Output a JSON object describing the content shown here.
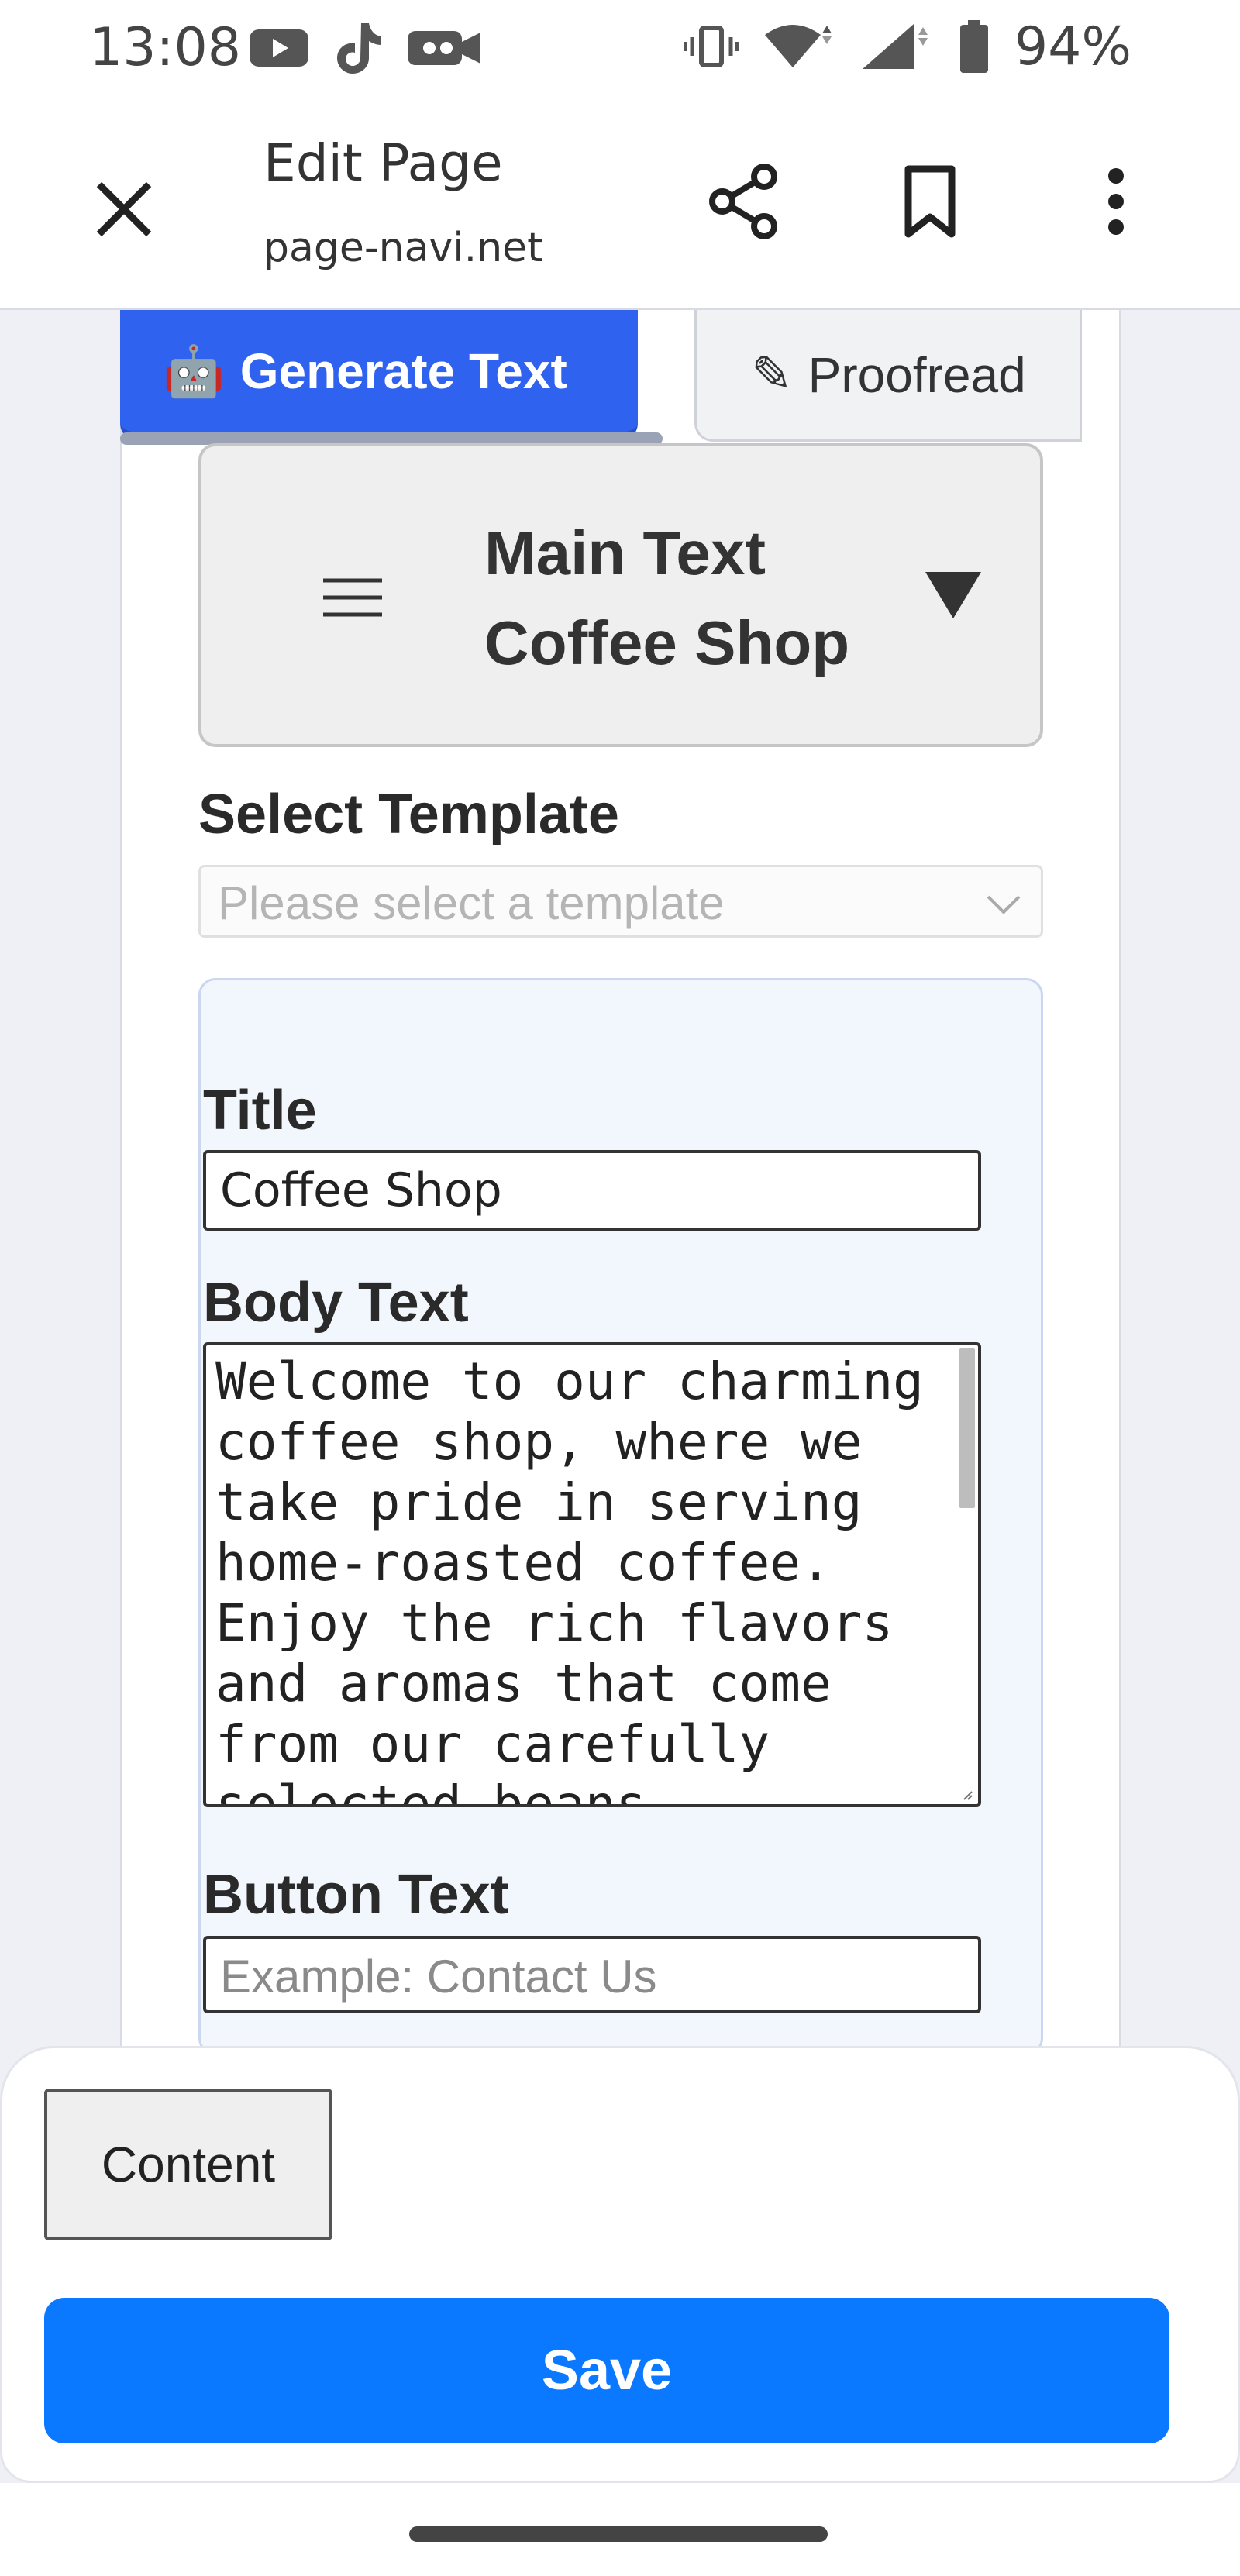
{
  "status_bar": {
    "time": "13:08",
    "battery": "94%",
    "icons_left": [
      "youtube-icon",
      "tiktok-icon",
      "video-camera-icon"
    ],
    "icons_right": [
      "vibrate-icon",
      "wifi-icon",
      "signal-icon",
      "battery-icon"
    ]
  },
  "browser": {
    "title": "Edit Page",
    "url": "page-navi.net"
  },
  "toolbar": {
    "generate_label": "Generate Text",
    "generate_icon": "🤖",
    "proofread_label": "Proofread",
    "proofread_icon": "✎"
  },
  "section": {
    "label_line1": "Main Text",
    "label_line2": "Coffee Shop"
  },
  "template": {
    "label": "Select Template",
    "placeholder": "Please select a template"
  },
  "form": {
    "title_label": "Title",
    "title_value": "Coffee Shop",
    "body_label": "Body Text",
    "body_value": "Welcome to our charming coffee shop, where we take pride in serving home-roasted coffee. Enjoy the rich flavors and aromas that come from our carefully selected beans.",
    "button_label": "Button Text",
    "button_placeholder": "Example: Contact Us"
  },
  "bottom": {
    "content_label": "Content",
    "save_label": "Save"
  },
  "colors": {
    "primary_blue": "#2f62ee",
    "save_blue": "#0a78ff"
  }
}
